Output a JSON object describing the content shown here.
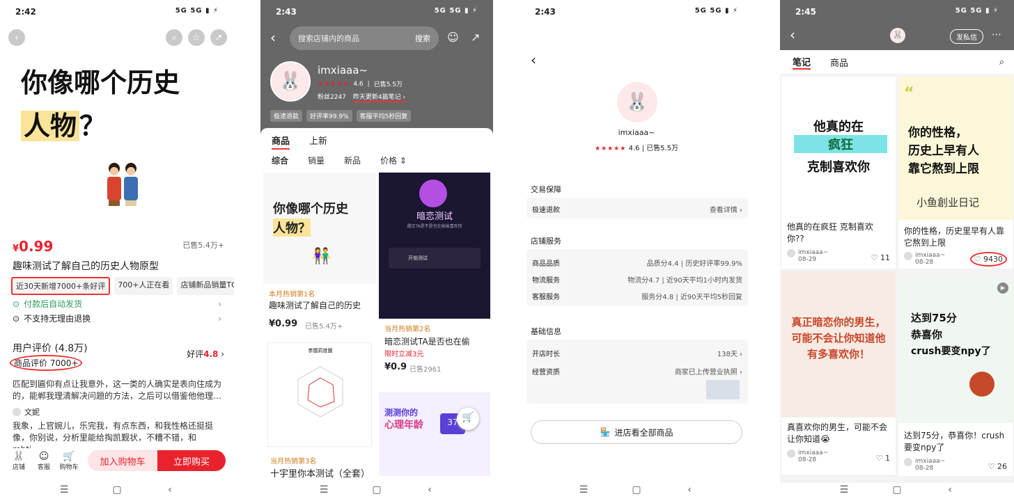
{
  "colors": {
    "accent": "#e8232d",
    "highlight": "#fbe49a",
    "dark_header": "#676767"
  },
  "status": {
    "p1_time": "2:42",
    "p2_time": "2:43",
    "p3_time": "2:43",
    "p4_time": "2:45",
    "signal": "5G 5G ▮ ⚡"
  },
  "p1": {
    "hero_line1": "你像哪个历史",
    "hero_line2_hl": "人物",
    "hero_line2_rest": "？",
    "price_symbol": "¥",
    "price": "0.99",
    "sold": "已售5.4万+",
    "title": "趣味测试了解自己的历史人物原型",
    "tags": [
      "近30天新增7000+条好评",
      "700+人正在看",
      "店铺新品销量TOP1"
    ],
    "ship": "付款后自动发货",
    "no_return": "不支持无理由退换",
    "review_hdr": "用户评价 (4.8万)",
    "review_sub": "商品评价 7000+",
    "good_label": "好评",
    "good_value": "4.8",
    "review1": "匹配到匾仰有点让我意外，这一类的人确实是表向住成为的，能郸我理清解决问題的方法，之后可以借鉴他他理…",
    "user": "文妮",
    "review2": "我象，上官婉儿，乐完我，有点东西，和我性格还挺挺像，你别说，分析里能给掏凯觐状，不糟不错，和mbti…",
    "shop": "店铺",
    "service": "客服",
    "cart_icon_label": "购物车",
    "add_cart": "加入购物车",
    "buy_now": "立即购买"
  },
  "p2": {
    "search_placeholder": "搜索店铺内的商品",
    "search_btn": "搜索",
    "shop_name": "imxiaaa~",
    "rating": "4.6",
    "sold": "已售5.5万",
    "fans": "粉丝2247",
    "update": "昨天更新4篇笔记 ›",
    "chips": [
      "极速退款",
      "好评率99.9%",
      "客服平均5秒回复"
    ],
    "tabs": [
      "商品",
      "上新"
    ],
    "sorts": [
      "综合",
      "销量",
      "新品",
      "价格 ⇕"
    ],
    "card1": {
      "hero1": "你像哪个历史",
      "hero2": "人物？",
      "badge": "本月热销第1名",
      "title": "趣味测试了解自己的历史",
      "price": "¥0.99",
      "sold": "已售5.4万+"
    },
    "card2": {
      "img_title": "暗恋测试",
      "sub": "遇见TA是不是也在偷偷喜欢你",
      "btn": "开始测试",
      "badge": "当月热销第2名",
      "title": "暗恋测试TA是否也在偷",
      "promo": "限时立减3元",
      "price": "¥0.9",
      "sold": "已售2961"
    },
    "card3": {
      "img_title": "参圜罰度圖"
    },
    "card4": {
      "img_title": "测测你的",
      "img_title2": "心理年龄",
      "num": "37"
    },
    "card5": {
      "badge": "当月热销第3名",
      "title": "十宇里你本测试（全套）"
    }
  },
  "p3": {
    "name": "imxiaaa~",
    "rating": "4.6",
    "sold": "已售5.5万",
    "sec1": "交易保障",
    "refund": "极速退款",
    "refund_val": "查看详情 ›",
    "sec2": "店铺服务",
    "quality": "商品品质",
    "quality_val": "品质分4.4 | 历史好评率99.9%",
    "logistics": "物流服务",
    "logistics_val": "物流分4.7 | 近90天平均1小时内发货",
    "cs": "客服服务",
    "cs_val": "服务分4.8 | 近90天平均5秒回复",
    "sec3": "基础信息",
    "age": "开店时长",
    "age_val": "138天 ›",
    "license": "经营资质",
    "license_val": "商家已上传营业执照 ›",
    "enter": "进店看全部商品"
  },
  "p4": {
    "msg_btn": "发私信",
    "tabs": [
      "笔记",
      "商品"
    ],
    "n1": {
      "big1": "他真的在",
      "big2": "疯狂",
      "big3": "克制喜欢你",
      "title": "他真的在疯狂 克制喜欢你??",
      "user": "imxiaaa~",
      "date": "08-29",
      "likes": "11"
    },
    "n2": {
      "big1": "你的性格，",
      "big2": "历史上早有人",
      "big3": "靠它熬到上限",
      "sign": "小鱼創业日记",
      "title": "你的性格，历史里早有人靠它熬到上限",
      "user": "imxiaaa~",
      "date": "08-28",
      "likes": "9430"
    },
    "n3": {
      "big": "真正暗恋你的男生，可能不会让你知道他有多喜欢你！",
      "title": "真喜欢你的男生，可能不会让你知道😭",
      "user": "imxiaaa~",
      "date": "08-28",
      "likes": "1"
    },
    "n4": {
      "big1": "达到75分",
      "big2": "恭喜你",
      "big3": "crush要变npy了",
      "title": "达到75分，恭喜你！crush要变npy了",
      "user": "imxiaaa~",
      "date": "08-28",
      "likes": "26"
    }
  }
}
